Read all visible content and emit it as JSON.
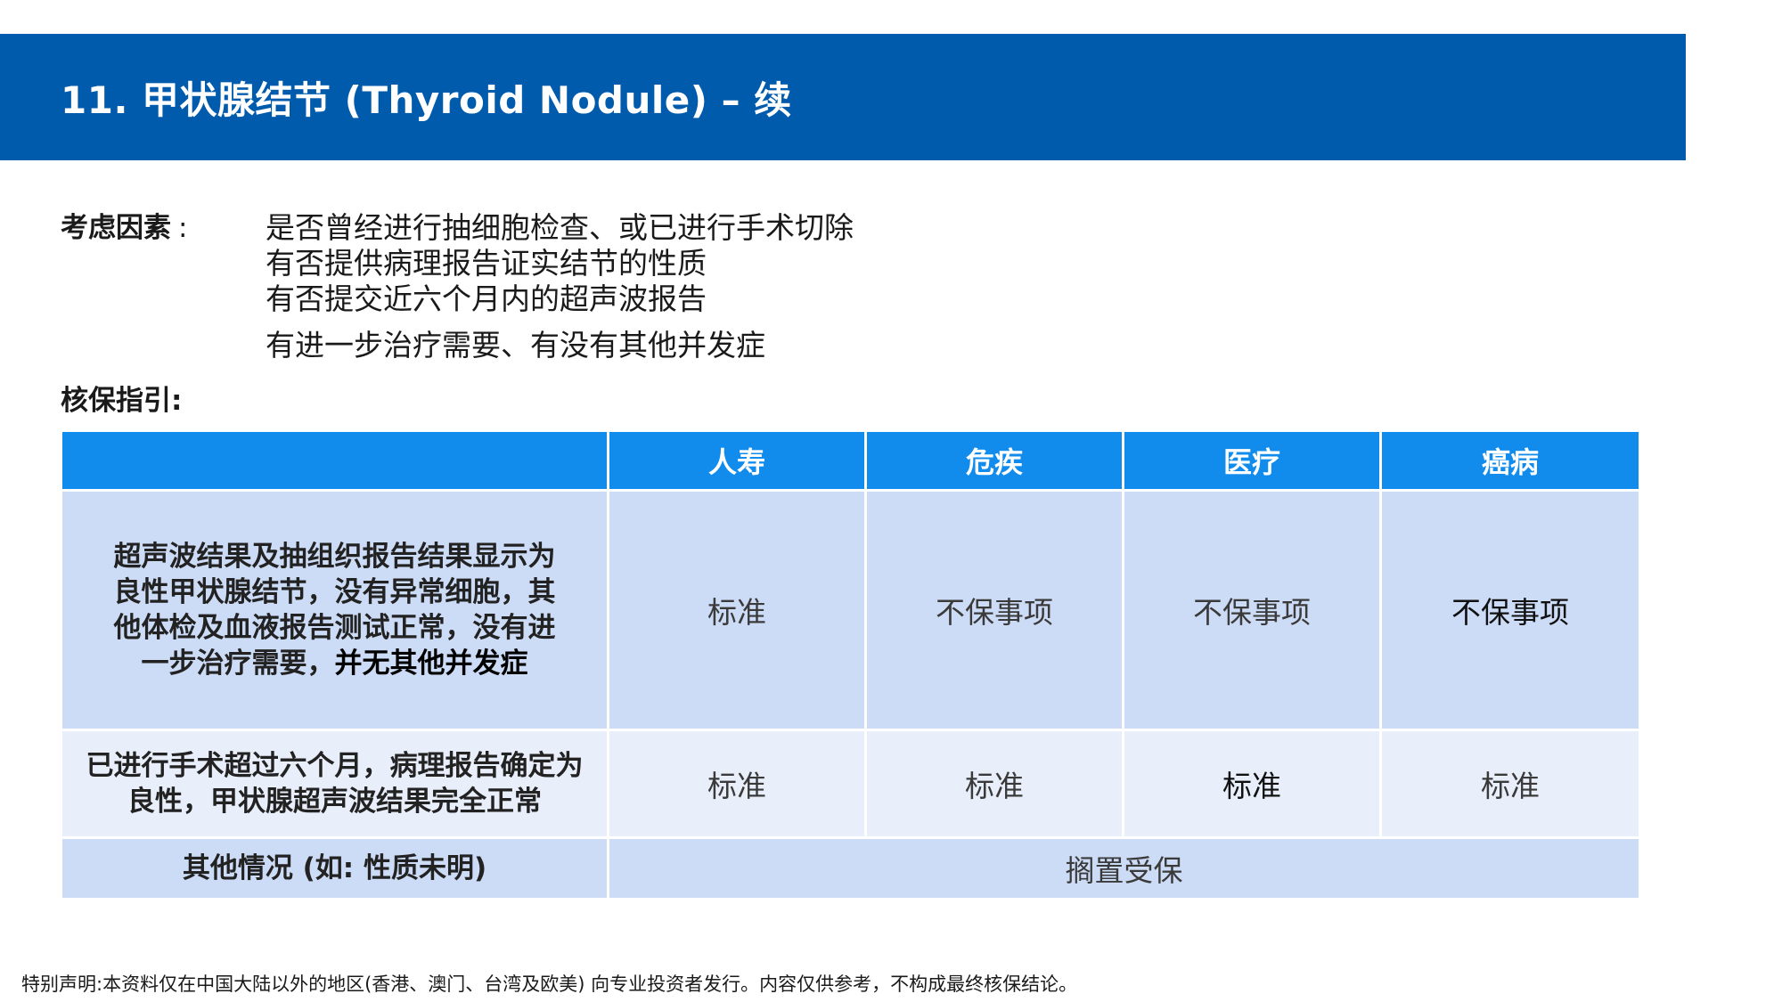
{
  "header": {
    "title": "11. 甲状腺结节 (Thyroid Nodule) – 续"
  },
  "considerations": {
    "label": "考虑因素",
    "colon": ":",
    "items": [
      "是否曾经进行抽细胞检查、或已进行手术切除",
      "有否提供病理报告证实结节的性质",
      "有否提交近六个月内的超声波报告",
      "有进一步治疗需要、有没有其他并发症"
    ]
  },
  "guidance": {
    "label": "核保指引:"
  },
  "table": {
    "columns": [
      "",
      "人寿",
      "危疾",
      "医疗",
      "癌病"
    ],
    "rows": [
      {
        "condition_part1": "超声波结果及抽组织报告结果显示为良性甲状腺结节，没有异常细胞，其他体检及血液报告测试正常，没有进一步治疗需要，",
        "condition_part2": "并无其他并发症",
        "values": [
          "标准",
          "不保事项",
          "不保事项",
          "不保事项"
        ]
      },
      {
        "condition": "已进行手术超过六个月，病理报告确定为良性，甲状腺超声波结果完全正常",
        "values": [
          "标准",
          "标准",
          "标准",
          "标准"
        ]
      },
      {
        "condition": "其他情况 (如: 性质未明)",
        "merged_value": "搁置受保"
      }
    ]
  },
  "footer": {
    "disclaimer": "特别声明:本资料仅在中国大陆以外的地区(香港、澳门、台湾及欧美) 向专业投资者发行。内容仅供参考，不构成最终核保结论。"
  },
  "colors": {
    "title_bar": "#005bac",
    "table_header": "#128cec",
    "row_dark": "#cddcf6",
    "row_light": "#e9effa"
  }
}
